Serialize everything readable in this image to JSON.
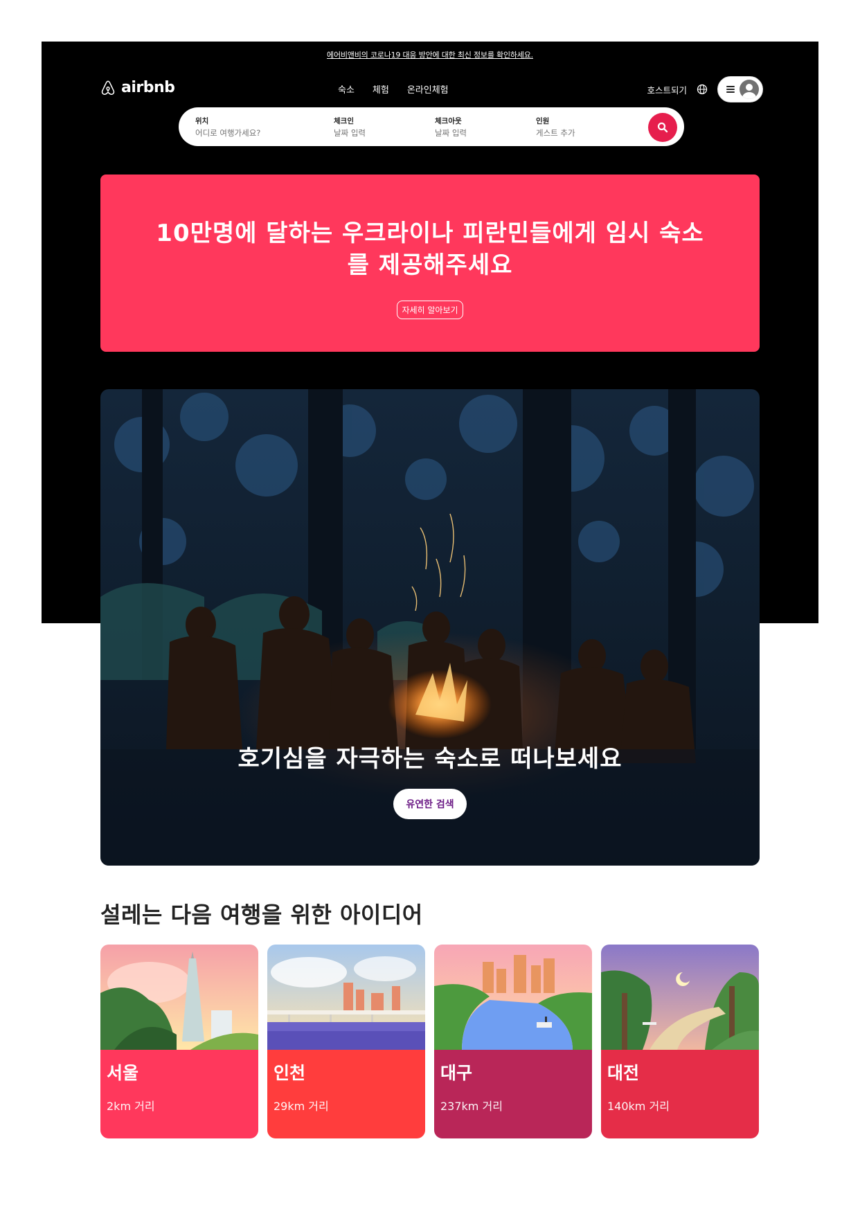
{
  "banner": {
    "covid_link": "에어비앤비의 코로나19 대응 방안에 대한 최신 정보를 확인하세요."
  },
  "header": {
    "brand": "airbnb",
    "tabs": [
      "숙소",
      "체험",
      "온라인체험"
    ],
    "host_link": "호스트되기"
  },
  "search": {
    "location": {
      "label": "위치",
      "placeholder": "어디로 여행가세요?"
    },
    "checkin": {
      "label": "체크인",
      "placeholder": "날짜 입력"
    },
    "checkout": {
      "label": "체크아웃",
      "placeholder": "날짜 입력"
    },
    "guests": {
      "label": "인원",
      "placeholder": "게스트 추가"
    }
  },
  "ukraine": {
    "title": "10만명에 달하는 우크라이나 피란민들에게 임시 숙소를 제공해주세요",
    "button": "자세히 알아보기"
  },
  "hero": {
    "title": "호기심을 자극하는 숙소로 떠나보세요",
    "button": "유연한 검색"
  },
  "ideas": {
    "title": "설레는 다음 여행을 위한 아이디어",
    "cards": [
      {
        "city": "서울",
        "distance": "2km 거리",
        "color": "#ff385c"
      },
      {
        "city": "인천",
        "distance": "29km 거리",
        "color": "#ff3d3d"
      },
      {
        "city": "대구",
        "distance": "237km 거리",
        "color": "#b92658"
      },
      {
        "city": "대전",
        "distance": "140km 거리",
        "color": "#e52d48"
      }
    ]
  },
  "colors": {
    "brand": "#ff385c",
    "search_button": "#e61e4d",
    "hero_button_text": "#6c1c86"
  }
}
